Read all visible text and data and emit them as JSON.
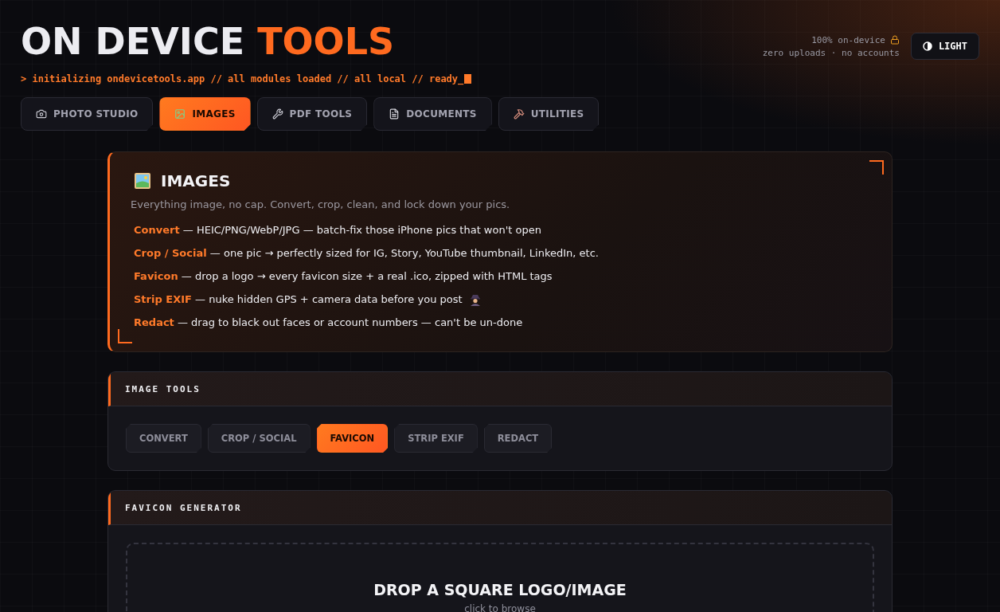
{
  "header": {
    "title": [
      {
        "text": "ON DEVICE",
        "accent": false
      },
      {
        "text": "TOOLS",
        "accent": true
      }
    ],
    "boot_line": "> initializing ondevicetools.app // all modules loaded // all local // ready_",
    "status_lines": [
      "100% on-device",
      "zero uploads · no accounts"
    ],
    "theme_button": "LIGHT"
  },
  "tabs": [
    {
      "label": "PHOTO STUDIO",
      "selected": false
    },
    {
      "label": "IMAGES",
      "selected": true
    },
    {
      "label": "PDF TOOLS",
      "selected": false
    },
    {
      "label": "DOCUMENTS",
      "selected": false
    },
    {
      "label": "UTILITIES",
      "selected": false
    }
  ],
  "intro": {
    "title": "IMAGES",
    "subtitle": "Everything image, no cap. Convert, crop, clean, and lock down your pics.",
    "features": [
      {
        "text": "**Convert** — HEIC/PNG/WebP/JPG — batch-fix those iPhone pics that won't open"
      },
      {
        "text": "**Crop / Social** — one pic → perfectly sized for IG, Story, YouTube thumbnail, LinkedIn, etc."
      },
      {
        "text": "**Favicon** — drop a logo → every favicon size + a real .ico, zipped with HTML tags"
      },
      {
        "text": "**Strip EXIF** — nuke hidden GPS + camera data before you post"
      },
      {
        "text": "**Redact** — drag to black out faces or account numbers — can't be un-done"
      }
    ]
  },
  "tool_panel": {
    "title": "IMAGE TOOLS",
    "tools": [
      {
        "label": "CONVERT",
        "selected": false
      },
      {
        "label": "CROP / SOCIAL",
        "selected": false
      },
      {
        "label": "FAVICON",
        "selected": true
      },
      {
        "label": "STRIP EXIF",
        "selected": false
      },
      {
        "label": "REDACT",
        "selected": false
      }
    ]
  },
  "generator": {
    "title": "FAVICON GENERATOR",
    "drop_title": "DROP A SQUARE LOGO/IMAGE",
    "drop_hint": "click to browse"
  }
}
